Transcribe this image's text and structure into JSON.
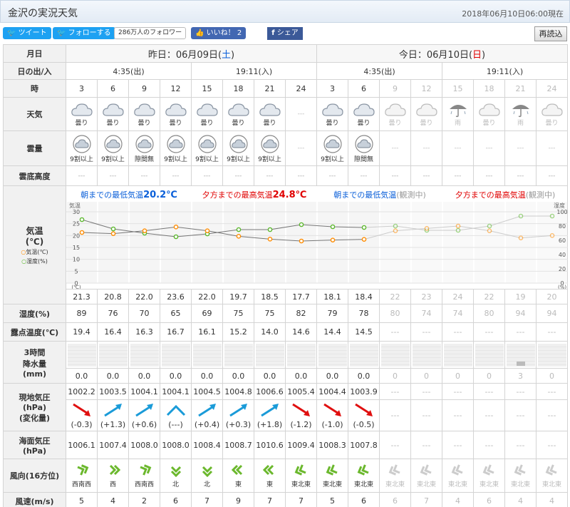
{
  "header": {
    "title": "金沢の実況天気",
    "stamp": "2018年06月10日06:00現在"
  },
  "social": {
    "tweet": "ツイート",
    "follow": "フォローする",
    "followers": "286万人のフォロワー",
    "like": "いいね！ 2",
    "share": "シェア",
    "reload": "再読込"
  },
  "labels": {
    "date": "月日",
    "sun": "日の出/入",
    "hour": "時",
    "weather": "天気",
    "cloud": "雲量",
    "ceiling": "雲底高度",
    "temp": "気温",
    "temp_unit": "(℃)",
    "legend_temp": "気温(℃)",
    "legend_hum": "湿度(%)",
    "humidity": "湿度(%)",
    "dew": "露点温度(℃)",
    "rain1": "3時間",
    "rain2": "降水量",
    "rain3": "(mm)",
    "press1": "現地気圧",
    "press2": "(hPa)",
    "press3": "(変化量)",
    "sea1": "海面気圧",
    "sea2": "(hPa)",
    "wdir": "風向(16方位)",
    "wspd": "風速(m/s)"
  },
  "days": [
    {
      "prefix": "昨日：06月09日(",
      "dow": "土",
      "suffix": ")",
      "sunrise": "4:35(出)",
      "sunset": "19:11(入)"
    },
    {
      "prefix": "今日：06月10日(",
      "dow": "日",
      "suffix": ")",
      "sunrise": "4:35(出)",
      "sunset": "19:11(入)"
    }
  ],
  "annotations": {
    "d1_min_label": "朝までの最低気温",
    "d1_min_val": "20.2℃",
    "d1_max_label": "夕方までの最高気温",
    "d1_max_val": "24.8℃",
    "d2_min_label": "朝までの最低気温",
    "d2_max_label": "夕方までの最高気温",
    "observing": "(観測中)"
  },
  "hours": [
    "3",
    "6",
    "9",
    "12",
    "15",
    "18",
    "21",
    "24",
    "3",
    "6",
    "9",
    "12",
    "15",
    "18",
    "21",
    "24"
  ],
  "observed": [
    true,
    true,
    true,
    true,
    true,
    true,
    true,
    false,
    true,
    true,
    false,
    false,
    false,
    false,
    false,
    false
  ],
  "weather": [
    "曇り",
    "曇り",
    "曇り",
    "曇り",
    "曇り",
    "曇り",
    "曇り",
    "---",
    "曇り",
    "曇り",
    "曇り",
    "曇り",
    "雨",
    "曇り",
    "雨",
    "曇り"
  ],
  "weather_icons": [
    "cloud-icon",
    "cloud-icon",
    "cloud-icon",
    "cloud-icon",
    "cloud-icon",
    "cloud-icon",
    "cloud-icon",
    "",
    "cloud-icon",
    "cloud-icon",
    "cloud-icon",
    "cloud-icon",
    "umbrella-icon",
    "cloud-icon",
    "umbrella-icon",
    "cloud-icon"
  ],
  "cloud_cover": [
    "9割以上",
    "9割以上",
    "隙間無",
    "9割以上",
    "9割以上",
    "9割以上",
    "9割以上",
    "---",
    "9割以上",
    "隙間無",
    "---",
    "---",
    "---",
    "---",
    "---",
    "---"
  ],
  "ceiling": [
    "---",
    "---",
    "---",
    "---",
    "---",
    "---",
    "---",
    "---",
    "---",
    "---",
    "---",
    "---",
    "---",
    "---",
    "---",
    "---"
  ],
  "temps": [
    "21.3",
    "20.8",
    "22.0",
    "23.6",
    "22.0",
    "19.7",
    "18.5",
    "17.7",
    "18.1",
    "18.4",
    "22",
    "23",
    "24",
    "22",
    "19",
    "20"
  ],
  "humidity": [
    "89",
    "76",
    "70",
    "65",
    "69",
    "75",
    "75",
    "82",
    "79",
    "78",
    "80",
    "74",
    "74",
    "80",
    "94",
    "94"
  ],
  "dew": [
    "19.4",
    "16.4",
    "16.3",
    "16.7",
    "16.1",
    "15.2",
    "14.0",
    "14.6",
    "14.4",
    "14.5",
    "---",
    "---",
    "---",
    "---",
    "---",
    "---"
  ],
  "rain": [
    "0.0",
    "0.0",
    "0.0",
    "0.0",
    "0.0",
    "0.0",
    "0.0",
    "0.0",
    "0.0",
    "0.0",
    "0",
    "0",
    "0",
    "0",
    "3",
    "0"
  ],
  "rain_levels": [
    0,
    0,
    0,
    0,
    0,
    0,
    0,
    0,
    0,
    0,
    0,
    0,
    0,
    0,
    3,
    0
  ],
  "pressure": [
    "1002.2",
    "1003.5",
    "1004.1",
    "1004.1",
    "1004.5",
    "1004.8",
    "1006.6",
    "1005.4",
    "1004.4",
    "1003.9",
    "---",
    "---",
    "---",
    "---",
    "---",
    "---"
  ],
  "pressure_change": [
    "(-0.3)",
    "(+1.3)",
    "(+0.6)",
    "(---)",
    "(+0.4)",
    "(+0.3)",
    "(+1.8)",
    "(-1.2)",
    "(-1.0)",
    "(-0.5)",
    "---",
    "---",
    "---",
    "---",
    "---",
    "---"
  ],
  "pressure_trend": [
    "down",
    "up",
    "up",
    "flat",
    "up",
    "up",
    "up",
    "down",
    "down",
    "down",
    "",
    "",
    "",
    "",
    "",
    ""
  ],
  "sea_pressure": [
    "1006.1",
    "1007.4",
    "1008.0",
    "1008.0",
    "1008.4",
    "1008.7",
    "1010.6",
    "1009.4",
    "1008.3",
    "1007.8",
    "---",
    "---",
    "---",
    "---",
    "---",
    "---"
  ],
  "wind_dir": [
    "西南西",
    "西",
    "西南西",
    "北",
    "北",
    "東",
    "東",
    "東北東",
    "東北東",
    "東北東",
    "東北東",
    "東北東",
    "東北東",
    "東北東",
    "東北東",
    "東北東"
  ],
  "wind_speed": [
    "5",
    "4",
    "2",
    "6",
    "7",
    "9",
    "7",
    "7",
    "5",
    "6",
    "6",
    "7",
    "4",
    "6",
    "4",
    "4"
  ],
  "colors": {
    "temp": "#ff8c00",
    "humidity": "#5cb82e",
    "saturday": "#0a5fd9",
    "sunday": "#e00000",
    "rise": "#1a9bd8",
    "fall": "#e01010"
  },
  "chart_data": {
    "type": "line",
    "x": [
      "3",
      "6",
      "9",
      "12",
      "15",
      "18",
      "21",
      "24",
      "3",
      "6",
      "9",
      "12",
      "15",
      "18",
      "21",
      "24"
    ],
    "series": [
      {
        "name": "気温(℃)",
        "axis": "left",
        "values": [
          21.3,
          20.8,
          22.0,
          23.6,
          22.0,
          19.7,
          18.5,
          17.7,
          18.1,
          18.4,
          22,
          23,
          24,
          22,
          19,
          20
        ]
      },
      {
        "name": "湿度(%)",
        "axis": "right",
        "values": [
          89,
          76,
          70,
          65,
          69,
          75,
          75,
          82,
          79,
          78,
          80,
          74,
          74,
          80,
          94,
          94
        ]
      }
    ],
    "ylabel": "気温",
    "y2label": "湿度",
    "ylim": [
      0,
      30
    ],
    "y2lim": [
      0,
      100
    ],
    "yticks": [
      "30",
      "25",
      "20",
      "15",
      "10",
      "5",
      "0"
    ],
    "y2ticks": [
      "100",
      "80",
      "60",
      "40",
      "20",
      "0"
    ],
    "ytick_bottom_unit": "(℃)",
    "y2tick_bottom_unit": "(%)",
    "observed_count": 10,
    "grid": true
  }
}
